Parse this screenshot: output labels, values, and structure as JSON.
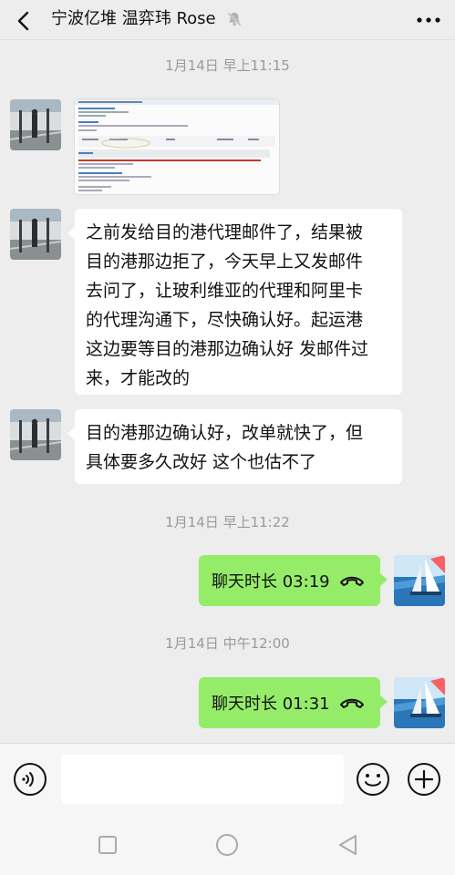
{
  "header": {
    "title": "宁波亿堆 温弈玮 Rose"
  },
  "timestamps": [
    "1月14日 早上11:15",
    "1月14日 早上11:22",
    "1月14日 中午12:00"
  ],
  "messages": {
    "msg2_lines": [
      "之前发给目的港代理邮件了，结果被",
      "目的港那边拒了，今天早上又发邮件",
      "去问了，让玻利维亚的代理和阿里卡",
      "的代理沟通下，尽快确认好。起运港",
      "这边要等目的港那边确认好 发邮件过",
      "来，才能改的"
    ],
    "msg3_lines": [
      "目的港那边确认好，改单就快了，但",
      "具体要多久改好 这个也估不了"
    ],
    "call1": "聊天时长 03:19",
    "call2": "聊天时长 01:31"
  },
  "input": {
    "value": ""
  },
  "colors": {
    "background": "#ededed",
    "bubble_other": "#ffffff",
    "bubble_self": "#95ec69",
    "timestamp": "#9a9a9a"
  },
  "icons": [
    "back-arrow-icon",
    "mute-bell-icon",
    "more-dots-icon",
    "voice-icon",
    "emoji-icon",
    "plus-icon",
    "phone-hangup-icon"
  ]
}
